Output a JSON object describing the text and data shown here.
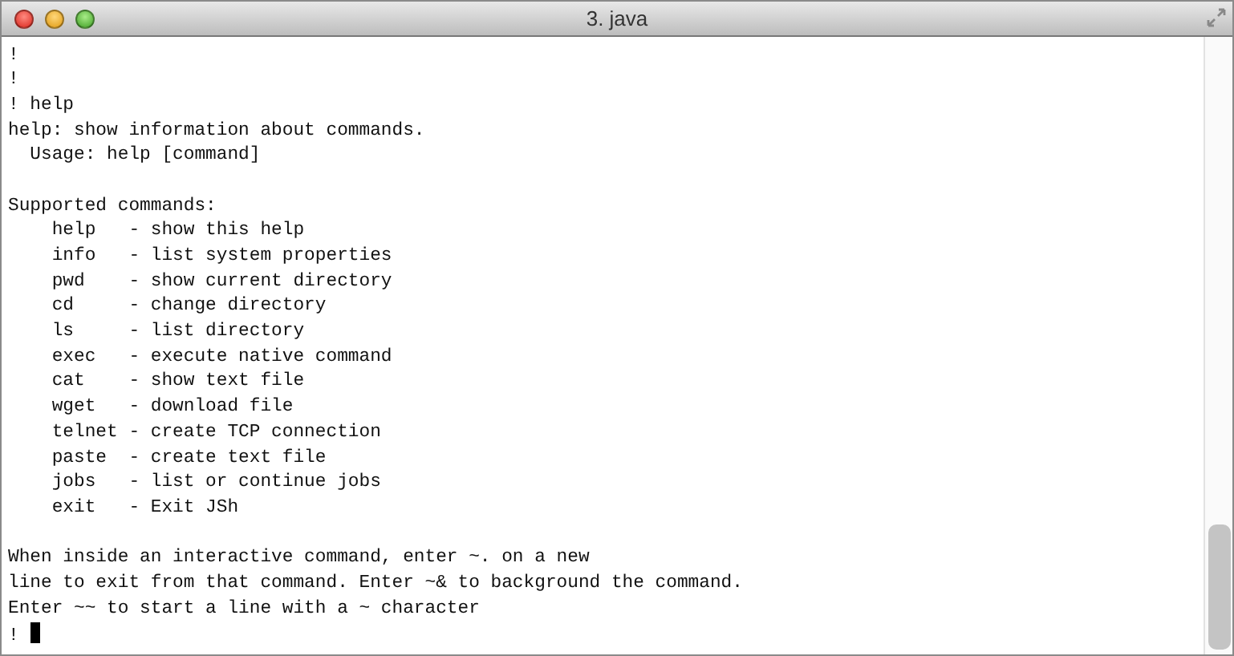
{
  "window": {
    "title": "3. java"
  },
  "terminal": {
    "lines": [
      {
        "kind": "text",
        "text": "!"
      },
      {
        "kind": "text",
        "text": "!"
      },
      {
        "kind": "text",
        "text": "! help"
      },
      {
        "kind": "text",
        "text": "help: show information about commands."
      },
      {
        "kind": "text",
        "text": "  Usage: help [command]"
      },
      {
        "kind": "blank"
      },
      {
        "kind": "text",
        "text": "Supported commands:"
      },
      {
        "kind": "text",
        "text": "    help   - show this help"
      },
      {
        "kind": "text",
        "text": "    info   - list system properties"
      },
      {
        "kind": "text",
        "text": "    pwd    - show current directory"
      },
      {
        "kind": "text",
        "text": "    cd     - change directory"
      },
      {
        "kind": "text",
        "text": "    ls     - list directory"
      },
      {
        "kind": "text",
        "text": "    exec   - execute native command"
      },
      {
        "kind": "text",
        "text": "    cat    - show text file"
      },
      {
        "kind": "text",
        "text": "    wget   - download file"
      },
      {
        "kind": "text",
        "text": "    telnet - create TCP connection"
      },
      {
        "kind": "text",
        "text": "    paste  - create text file"
      },
      {
        "kind": "text",
        "text": "    jobs   - list or continue jobs"
      },
      {
        "kind": "text",
        "text": "    exit   - Exit JSh"
      },
      {
        "kind": "blank"
      },
      {
        "kind": "text",
        "text": "When inside an interactive command, enter ~. on a new"
      },
      {
        "kind": "text",
        "text": "line to exit from that command. Enter ~& to background the command."
      },
      {
        "kind": "text",
        "text": "Enter ~~ to start a line with a ~ character"
      },
      {
        "kind": "prompt",
        "text": "!"
      }
    ]
  }
}
